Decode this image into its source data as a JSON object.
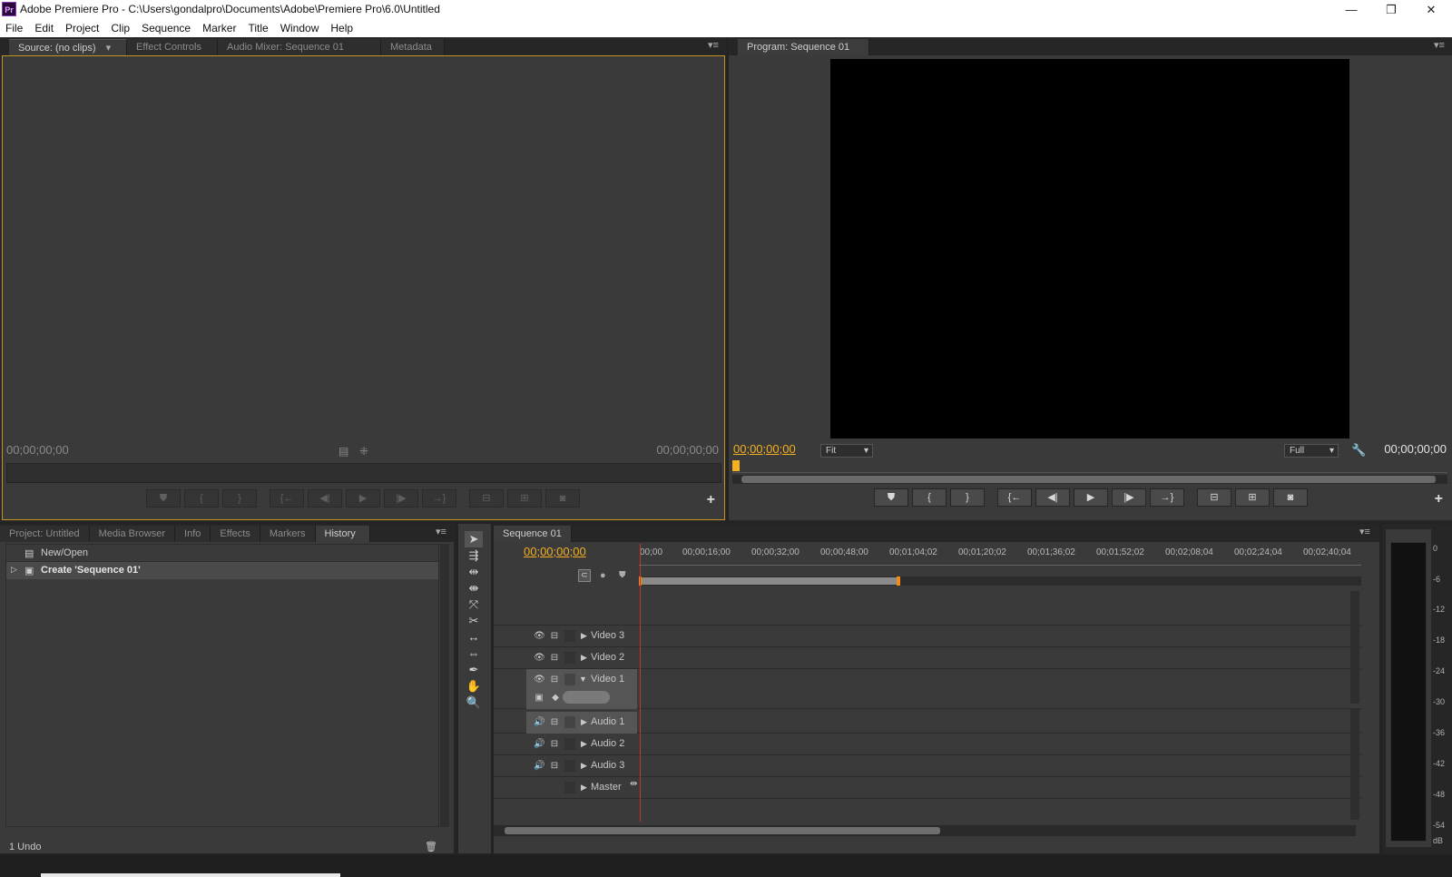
{
  "window": {
    "title": "Adobe Premiere Pro - C:\\Users\\gondalpro\\Documents\\Adobe\\Premiere Pro\\6.0\\Untitled",
    "app_icon": "Pr",
    "minimize": "—",
    "restore": "❐",
    "close": "✕"
  },
  "menu": [
    "File",
    "Edit",
    "Project",
    "Clip",
    "Sequence",
    "Marker",
    "Title",
    "Window",
    "Help"
  ],
  "source_panel": {
    "tabs": [
      "Source: (no clips)",
      "Effect Controls",
      "Audio Mixer: Sequence 01",
      "Metadata"
    ],
    "timecode_left": "00;00;00;00",
    "timecode_right": "00;00;00;00"
  },
  "program_panel": {
    "tab": "Program: Sequence 01",
    "timecode_left": "00;00;00;00",
    "zoom": "Fit",
    "quality": "Full",
    "timecode_right": "00;00;00;00"
  },
  "project_panel": {
    "tabs": [
      "Project: Untitled",
      "Media Browser",
      "Info",
      "Effects",
      "Markers",
      "History"
    ],
    "history_items": [
      "New/Open",
      "Create 'Sequence 01'"
    ],
    "undo_count": "1 Undo"
  },
  "timeline": {
    "tab": "Sequence 01",
    "timecode": "00;00;00;00",
    "ruler_labels": [
      "00;00",
      "00;00;16;00",
      "00;00;32;00",
      "00;00;48;00",
      "00;01;04;02",
      "00;01;20;02",
      "00;01;36;02",
      "00;01;52;02",
      "00;02;08;04",
      "00;02;24;04",
      "00;02;40;04"
    ],
    "video_tracks": [
      "Video 3",
      "Video 2",
      "Video 1"
    ],
    "audio_tracks": [
      "Audio 1",
      "Audio 2",
      "Audio 3"
    ],
    "master": "Master"
  },
  "audio_meter": {
    "labels": [
      "0",
      "-6",
      "-12",
      "-18",
      "-24",
      "-30",
      "-36",
      "-42",
      "-48",
      "-54",
      "dB"
    ]
  },
  "colors": {
    "accent_yellow": "#f4b021",
    "panel_bg": "#3a3a3a",
    "playhead_red": "#c8342a"
  }
}
